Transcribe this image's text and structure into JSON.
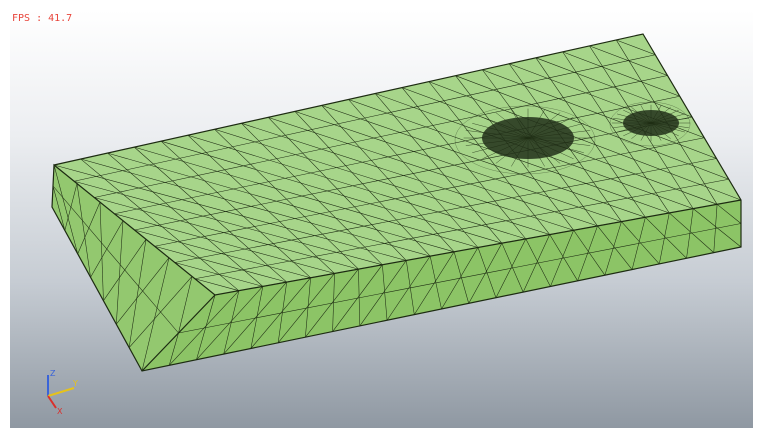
{
  "overlay": {
    "fps_text": "FPS : 41.7"
  },
  "mesh": {
    "face_color": "#a7d58a",
    "side_color": "#93c86f",
    "front_color": "#8cc466",
    "line_color": "#1d2b12",
    "refined_regions": 2
  },
  "triad": {
    "x_label": "X",
    "y_label": "Y",
    "z_label": "Z",
    "x_color": "#d9302c",
    "y_color": "#e6c21a",
    "z_color": "#3a64d8"
  }
}
